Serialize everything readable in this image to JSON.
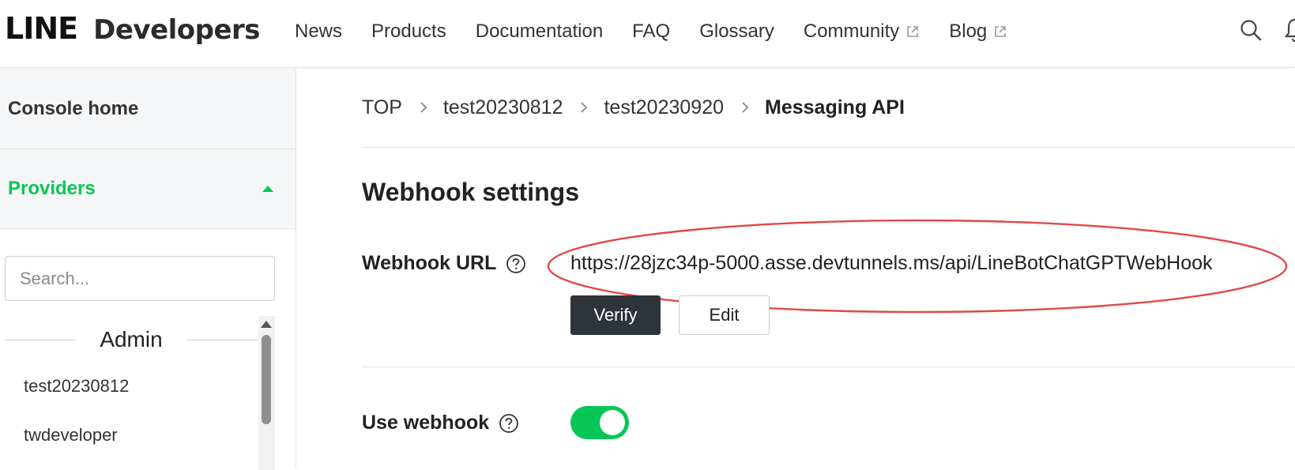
{
  "header": {
    "logo_line": "LINE",
    "logo_developers": "Developers",
    "nav": [
      {
        "label": "News",
        "external": false
      },
      {
        "label": "Products",
        "external": false
      },
      {
        "label": "Documentation",
        "external": false
      },
      {
        "label": "FAQ",
        "external": false
      },
      {
        "label": "Glossary",
        "external": false
      },
      {
        "label": "Community",
        "external": true
      },
      {
        "label": "Blog",
        "external": true
      }
    ],
    "icons": [
      "search-icon",
      "bell-icon"
    ]
  },
  "sidebar": {
    "console_home": "Console home",
    "providers": "Providers",
    "search_placeholder": "Search...",
    "group_label": "Admin",
    "items": [
      {
        "label": "test20230812"
      },
      {
        "label": "twdeveloper"
      }
    ]
  },
  "breadcrumb": {
    "items": [
      "TOP",
      "test20230812",
      "test20230920"
    ],
    "current": "Messaging API"
  },
  "webhook": {
    "section_title": "Webhook settings",
    "url_label": "Webhook URL",
    "url_value": "https://28jzc34p-5000.asse.devtunnels.ms/api/LineBotChatGPTWebHook",
    "verify_label": "Verify",
    "edit_label": "Edit",
    "use_label": "Use webhook",
    "use_enabled": true
  },
  "colors": {
    "brand_green": "#06c755",
    "dark_button": "#2f343b",
    "annotation_red": "#e04848"
  }
}
